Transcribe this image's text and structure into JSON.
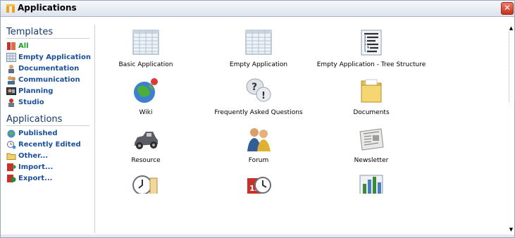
{
  "window": {
    "title": "Applications",
    "close_glyph": "✕"
  },
  "sidebar": {
    "templates_heading": "Templates",
    "templates": [
      {
        "label": "All",
        "icon": "all-templates-icon",
        "active": true
      },
      {
        "label": "Empty Application",
        "icon": "grid-icon",
        "active": false
      },
      {
        "label": "Documentation",
        "icon": "documentation-icon",
        "active": false
      },
      {
        "label": "Communication",
        "icon": "communication-icon",
        "active": false
      },
      {
        "label": "Planning",
        "icon": "planning-icon",
        "active": false
      },
      {
        "label": "Studio",
        "icon": "studio-icon",
        "active": false
      }
    ],
    "applications_heading": "Applications",
    "applications": [
      {
        "label": "Published",
        "icon": "published-icon"
      },
      {
        "label": "Recently Edited",
        "icon": "recently-edited-icon"
      },
      {
        "label": "Other...",
        "icon": "folder-icon"
      },
      {
        "label": "Import...",
        "icon": "import-icon"
      },
      {
        "label": "Export...",
        "icon": "export-icon"
      }
    ]
  },
  "grid": {
    "items": [
      {
        "label": "Basic Application",
        "icon": "grid-table-icon"
      },
      {
        "label": "Empty Application",
        "icon": "grid-table-icon"
      },
      {
        "label": "Empty Application - Tree Structure",
        "icon": "tree-structure-icon"
      },
      {
        "label": "Wiki",
        "icon": "globe-icon"
      },
      {
        "label": "Frequently Asked Questions",
        "icon": "faq-icon"
      },
      {
        "label": "Documents",
        "icon": "documents-folder-icon"
      },
      {
        "label": "Resource",
        "icon": "car-icon"
      },
      {
        "label": "Forum",
        "icon": "forum-people-icon"
      },
      {
        "label": "Newsletter",
        "icon": "newspaper-icon"
      },
      {
        "label": "",
        "icon": "clock-scroll-icon"
      },
      {
        "label": "",
        "icon": "calendar-clock-icon"
      },
      {
        "label": "",
        "icon": "bar-chart-icon"
      }
    ]
  },
  "colors": {
    "accent": "#1a4f9e",
    "active": "#1f9b28",
    "heading": "#163a73",
    "close": "#c8311d"
  }
}
